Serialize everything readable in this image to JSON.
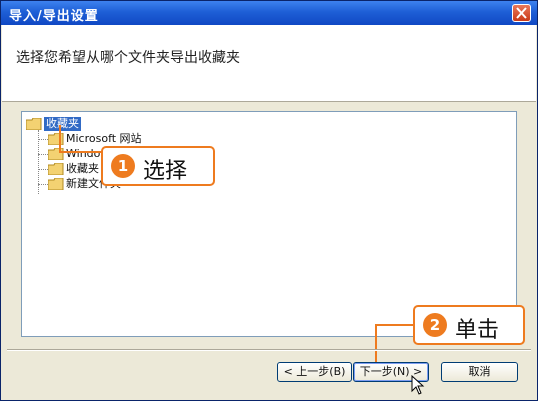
{
  "window": {
    "title": "导入/导出设置"
  },
  "header": {
    "instruction": "选择您希望从哪个文件夹导出收藏夹"
  },
  "tree": {
    "root": "收藏夹",
    "children": [
      "Microsoft 网站",
      "Windo",
      "收藏夹",
      "新建文件夹"
    ]
  },
  "buttons": {
    "back": "< 上一步(B)",
    "next": "下一步(N) >",
    "cancel": "取消"
  },
  "callouts": [
    {
      "number": "1",
      "text": "选择"
    },
    {
      "number": "2",
      "text": "单击"
    }
  ],
  "colors": {
    "accent": "#ee7b1f",
    "selection": "#316ac5",
    "titlebar": "#1e5fd6"
  }
}
